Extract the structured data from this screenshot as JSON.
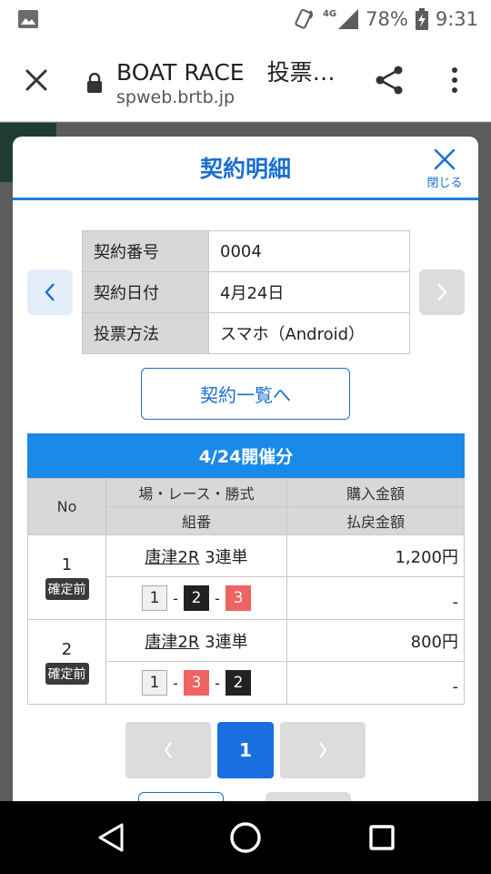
{
  "status_bar": {
    "network": "4G",
    "battery": "78%",
    "time": "9:31",
    "icons": [
      "image-icon",
      "vibrate-icon",
      "signal-icon",
      "battery-charging-icon"
    ]
  },
  "browser": {
    "page_title": "BOAT RACE　投票…",
    "url": "spweb.brtb.jp",
    "icons": [
      "close-icon",
      "lock-icon",
      "share-icon",
      "more-vert-icon"
    ]
  },
  "modal": {
    "title": "契約明細",
    "close_label": "閉じる",
    "info": [
      {
        "key": "契約番号",
        "value": "0004"
      },
      {
        "key": "契約日付",
        "value": "4月24日"
      },
      {
        "key": "投票方法",
        "value": "スマホ（Android）"
      }
    ],
    "list_button": "契約一覧へ",
    "section_title": "4/24開催分",
    "table": {
      "headers": {
        "no": "No",
        "race_info": "場・レース・勝式",
        "combination": "組番",
        "purchase": "購入金額",
        "payout": "払戻金額"
      },
      "rows": [
        {
          "no": "1",
          "status": "確定前",
          "place": "唐津2R",
          "bet_type": "3連単",
          "combo": [
            {
              "n": "1",
              "color": "#f0f0f0"
            },
            {
              "n": "2",
              "color": "#222222"
            },
            {
              "n": "3",
              "color": "#f06363"
            }
          ],
          "sep": "-",
          "purchase": "1,200円",
          "payout": "-"
        },
        {
          "no": "2",
          "status": "確定前",
          "place": "唐津2R",
          "bet_type": "3連単",
          "combo": [
            {
              "n": "1",
              "color": "#f0f0f0"
            },
            {
              "n": "3",
              "color": "#f06363"
            },
            {
              "n": "2",
              "color": "#222222"
            }
          ],
          "sep": "-",
          "purchase": "800円",
          "payout": "-"
        }
      ]
    },
    "pager": {
      "current": "1"
    }
  },
  "colors": {
    "accent": "#1a6fd0",
    "section_bar": "#1a8ae8",
    "current_page": "#1a6fe0"
  }
}
